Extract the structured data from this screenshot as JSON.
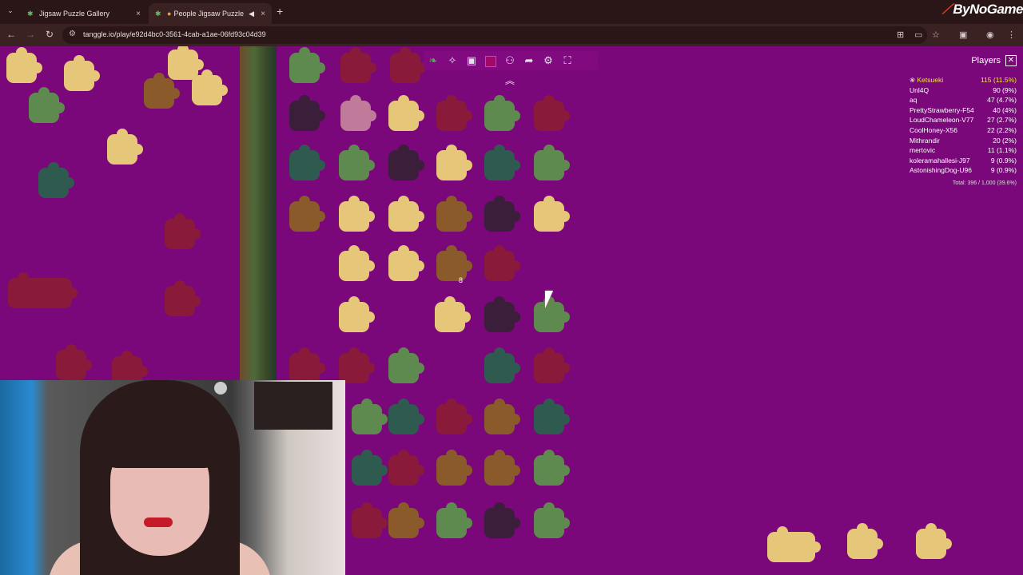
{
  "tabs": [
    {
      "label": "Jigsaw Puzzle Gallery",
      "active": false
    },
    {
      "label": "People Jigsaw Puzzle",
      "active": true
    }
  ],
  "tab_controls": {
    "tab_list_icon": "chevron-down-icon",
    "new_tab": "+",
    "close": "×",
    "audio_icon": "speaker-icon"
  },
  "brand": {
    "name": "ByNoGame"
  },
  "address": {
    "url": "tanggle.io/play/e92d4bc0-3561-4cab-a1ae-06fd93c04d39"
  },
  "toolbar": {
    "items": [
      "logo-icon",
      "puzzle-piece-icon",
      "image-preview-icon",
      "color-swatch",
      "players-icon",
      "share-icon",
      "settings-icon",
      "fullscreen-icon"
    ],
    "background_color": "#a0086a"
  },
  "players_panel": {
    "title": "Players",
    "close": "✕",
    "players": [
      {
        "name": "Ketsueki",
        "score": "115 (11.5%)"
      },
      {
        "name": "Unl4Q",
        "score": "90 (9%)"
      },
      {
        "name": "aq",
        "score": "47 (4.7%)"
      },
      {
        "name": "PrettyStrawberry-F54",
        "score": "40 (4%)"
      },
      {
        "name": "LoudChameleon-V77",
        "score": "27 (2.7%)"
      },
      {
        "name": "CoolHoney-X56",
        "score": "22 (2.2%)"
      },
      {
        "name": "Mithrandir",
        "score": "20 (2%)"
      },
      {
        "name": "mertovic",
        "score": "11 (1.1%)"
      },
      {
        "name": "koleramahallesi-J97",
        "score": "9 (0.9%)"
      },
      {
        "name": "AstonishingDog-U96",
        "score": "9 (0.9%)"
      }
    ],
    "total": "Total: 396 / 1,000 (39.6%)"
  },
  "cursor_label": "8",
  "colors": {
    "board": "#7a087a",
    "accent_top_player": "#f2e34a"
  }
}
